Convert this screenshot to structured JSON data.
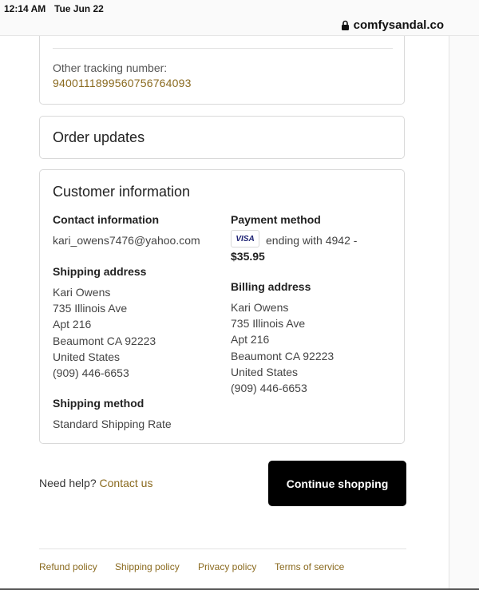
{
  "status": {
    "time": "12:14 AM",
    "date": "Tue Jun 22"
  },
  "browser": {
    "url": "comfysandal.co",
    "lock_icon": "lock-icon"
  },
  "tracking": {
    "label": "Other tracking number:",
    "number": "9400111899560756764093"
  },
  "order_updates": {
    "title": "Order updates"
  },
  "customer": {
    "title": "Customer information",
    "contact": {
      "title": "Contact information",
      "email": "kari_owens7476@yahoo.com"
    },
    "payment": {
      "title": "Payment method",
      "card_brand": "VISA",
      "ending": "ending with 4942 -",
      "amount": "$35.95"
    },
    "shipping_address": {
      "title": "Shipping address",
      "lines": [
        "Kari Owens",
        "735 Illinois Ave",
        "Apt 216",
        "Beaumont CA 92223",
        "United States",
        "(909) 446-6653"
      ]
    },
    "billing_address": {
      "title": "Billing address",
      "lines": [
        "Kari Owens",
        "735 Illinois Ave",
        "Apt 216",
        "Beaumont CA 92223",
        "United States",
        "(909) 446-6653"
      ]
    },
    "shipping_method": {
      "title": "Shipping method",
      "value": "Standard Shipping Rate"
    }
  },
  "help": {
    "text": "Need help?",
    "link": "Contact us"
  },
  "cta": {
    "label": "Continue shopping"
  },
  "footer": {
    "links": [
      "Refund policy",
      "Shipping policy",
      "Privacy policy",
      "Terms of service"
    ]
  },
  "colors": {
    "link": "#8a6a1f",
    "button": "#000000",
    "visa": "#1a1f71"
  }
}
